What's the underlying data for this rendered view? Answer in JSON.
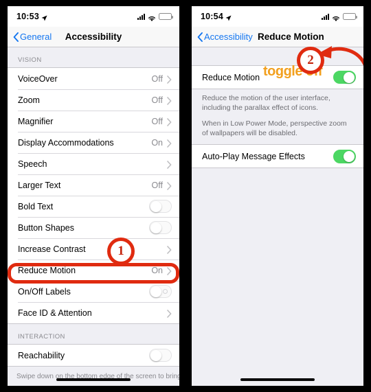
{
  "left_phone": {
    "status_bar": {
      "time": "10:53",
      "location_icon": "location-arrow-icon",
      "signal_icon": "cellular-bars-icon",
      "wifi_icon": "wifi-icon",
      "battery_icon": "battery-icon",
      "battery_color": "#f6c931"
    },
    "nav": {
      "back_label": "General",
      "title": "Accessibility"
    },
    "sections": [
      {
        "header": "VISION",
        "rows": [
          {
            "label": "VoiceOver",
            "value": "Off",
            "type": "disclosure"
          },
          {
            "label": "Zoom",
            "value": "Off",
            "type": "disclosure"
          },
          {
            "label": "Magnifier",
            "value": "Off",
            "type": "disclosure"
          },
          {
            "label": "Display Accommodations",
            "value": "On",
            "type": "disclosure"
          },
          {
            "label": "Speech",
            "value": "",
            "type": "disclosure"
          },
          {
            "label": "Larger Text",
            "value": "Off",
            "type": "disclosure"
          },
          {
            "label": "Bold Text",
            "value": "",
            "type": "toggle",
            "toggle": "off"
          },
          {
            "label": "Button Shapes",
            "value": "",
            "type": "toggle",
            "toggle": "off"
          },
          {
            "label": "Increase Contrast",
            "value": "",
            "type": "disclosure"
          },
          {
            "label": "Reduce Motion",
            "value": "On",
            "type": "disclosure",
            "highlighted": true
          },
          {
            "label": "On/Off Labels",
            "value": "",
            "type": "toggle",
            "toggle": "off-labeled"
          },
          {
            "label": "Face ID & Attention",
            "value": "",
            "type": "disclosure"
          }
        ]
      },
      {
        "header": "INTERACTION",
        "rows": [
          {
            "label": "Reachability",
            "value": "",
            "type": "toggle",
            "toggle": "off"
          }
        ]
      }
    ],
    "bottom_hint": "Swipe down on the bottom edge of the screen to bring",
    "annotation": {
      "badge": "1",
      "highlight_color": "#e02b10"
    }
  },
  "right_phone": {
    "status_bar": {
      "time": "10:54",
      "location_icon": "location-arrow-icon",
      "signal_icon": "cellular-bars-icon",
      "wifi_icon": "wifi-icon",
      "battery_icon": "battery-icon",
      "battery_color": "#f6c931"
    },
    "nav": {
      "back_label": "Accessibility",
      "title": "Reduce Motion"
    },
    "rows": [
      {
        "label": "Reduce Motion",
        "type": "toggle",
        "toggle": "on"
      }
    ],
    "footnotes": [
      "Reduce the motion of the user interface, including the parallax effect of icons.",
      "When in Low Power Mode, perspective zoom of wallpapers will be disabled."
    ],
    "rows2": [
      {
        "label": "Auto-Play Message Effects",
        "type": "toggle",
        "toggle": "on"
      }
    ],
    "annotation": {
      "badge": "2",
      "callout_text": "toggle off",
      "callout_color": "#f2a01e",
      "arrow": "curved-arrow-icon",
      "arrow_color": "#e02b10"
    }
  }
}
